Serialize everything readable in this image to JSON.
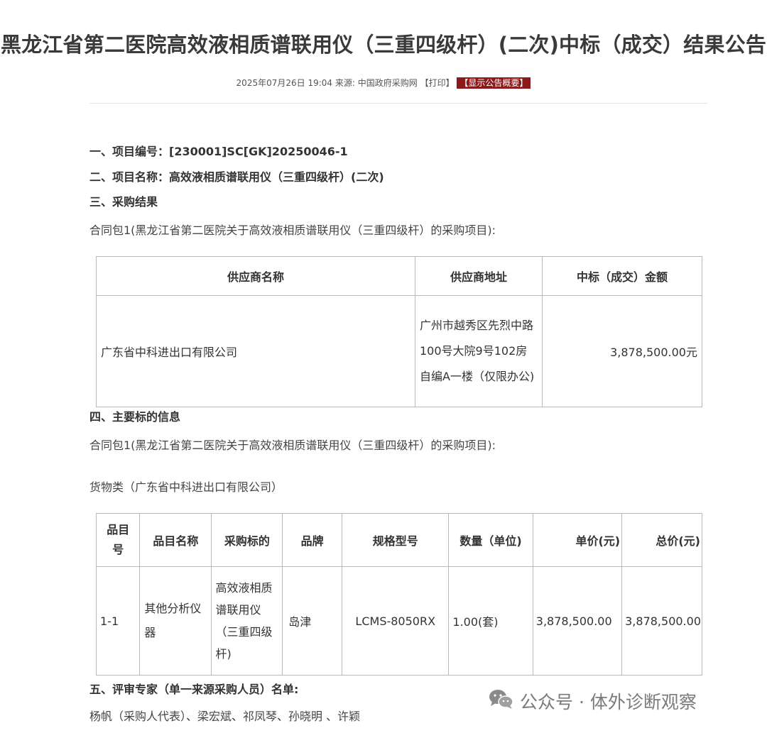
{
  "title": "黑龙江省第二医院高效液相质谱联用仪（三重四级杆）(二次)中标（成交）结果公告",
  "meta": {
    "datetime": "2025年07月26日 19:04",
    "source_label": "来源:",
    "source": "中国政府采购网",
    "print": "【打印】",
    "summary_button": "【显示公告概要】"
  },
  "sections": {
    "s1": "一、项目编号：[230001]SC[GK]20250046-1",
    "s2": "二、项目名称：高效液相质谱联用仪（三重四级杆）(二次)",
    "s3": "三、采购结果",
    "s3_package": "合同包1(黑龙江省第二医院关于高效液相质谱联用仪（三重四级杆）的采购项目):",
    "s4": "四、主要标的信息",
    "s4_package": "合同包1(黑龙江省第二医院关于高效液相质谱联用仪（三重四级杆）的采购项目):",
    "s4_category": "货物类（广东省中科进出口有限公司）",
    "s5": "五、评审专家（单一来源采购人员）名单:",
    "s5_names": "杨帆（采购人代表）、梁宏斌、祁凤琴、孙晓明 、许颖"
  },
  "result_table": {
    "headers": [
      "供应商名称",
      "供应商地址",
      "中标（成交）金额"
    ],
    "row": {
      "supplier": "广东省中科进出口有限公司",
      "address": "广州市越秀区先烈中路100号大院9号102房自编A一楼（仅限办公)",
      "amount": "3,878,500.00元"
    }
  },
  "item_table": {
    "headers": [
      "品目号",
      "品目名称",
      "采购标的",
      "品牌",
      "规格型号",
      "数量（单位)",
      "单价(元)",
      "总价(元)"
    ],
    "row": {
      "no": "1-1",
      "name": "其他分析仪器",
      "target": "高效液相质谱联用仪（三重四级杆)",
      "brand": "岛津",
      "model": "LCMS-8050RX",
      "quantity": "1.00(套)",
      "unit_price": "3,878,500.00",
      "total_price": "3,878,500.00"
    }
  },
  "watermark": {
    "text": "公众号 · 体外诊断观察",
    "icon": "wechat-icon"
  },
  "colors": {
    "badge_bg": "#8b1a1a",
    "text": "#333333",
    "border": "#b9b9b9"
  }
}
